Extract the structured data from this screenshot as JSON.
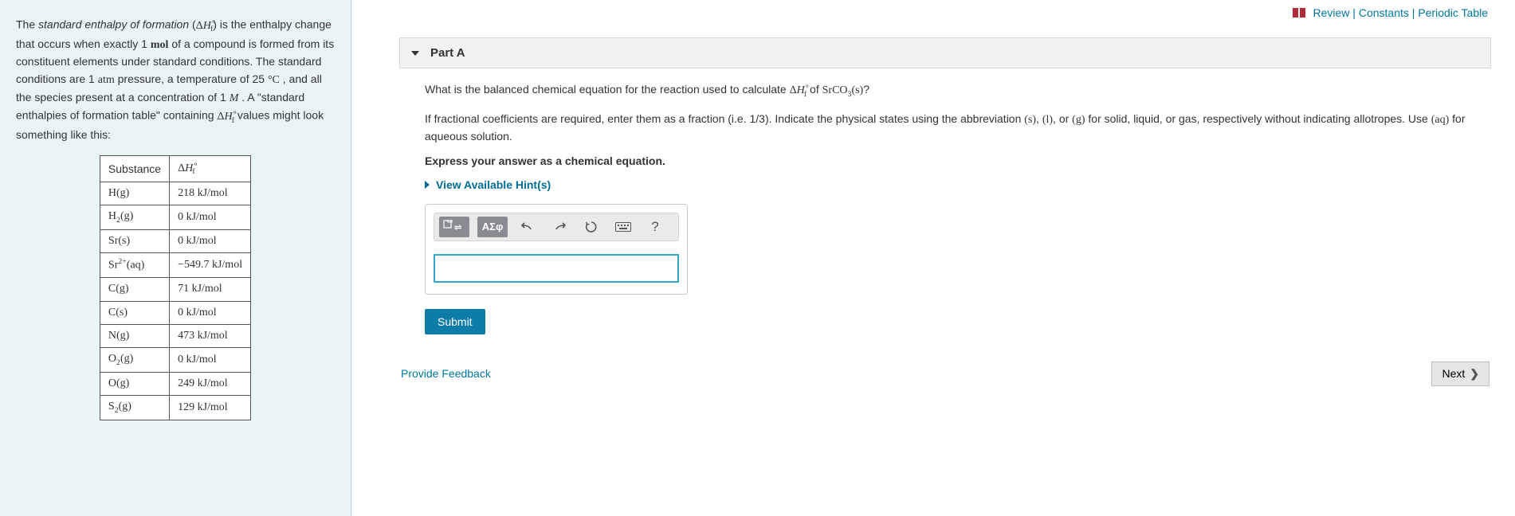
{
  "topLinks": {
    "review": "Review",
    "constants": "Constants",
    "periodic": "Periodic Table"
  },
  "intro": {
    "text1_a": "The ",
    "term": "standard enthalpy of formation",
    "text1_b": " (",
    "dHf_html": "ΔH∘f",
    "text1_c": ") is the enthalpy change that occurs when exactly 1 ",
    "mol": "mol",
    "text1_d": " of a compound is formed from its constituent elements under standard conditions. The standard conditions are 1 ",
    "atm": "atm",
    "text1_e": " pressure, a temperature of 25 ",
    "degC": "°C",
    "text1_f": " , and all the species present at a concentration of 1 ",
    "M": "M",
    "text1_g": " . A \"standard enthalpies of formation table\" containing ",
    "text1_h": " values might look something like this:"
  },
  "table": {
    "h1": "Substance",
    "h2_html": "ΔH∘f",
    "rows": [
      {
        "sub": "H(g)",
        "val": "218 kJ/mol"
      },
      {
        "sub": "H2(g)",
        "val": "0 kJ/mol"
      },
      {
        "sub": "Sr(s)",
        "val": "0 kJ/mol"
      },
      {
        "sub": "Sr2+(aq)",
        "val": "−549.7 kJ/mol"
      },
      {
        "sub": "C(g)",
        "val": "71 kJ/mol"
      },
      {
        "sub": "C(s)",
        "val": "0 kJ/mol"
      },
      {
        "sub": "N(g)",
        "val": "473 kJ/mol"
      },
      {
        "sub": "O2(g)",
        "val": "0 kJ/mol"
      },
      {
        "sub": "O(g)",
        "val": "249 kJ/mol"
      },
      {
        "sub": "S2(g)",
        "val": "129 kJ/mol"
      }
    ]
  },
  "partHeader": "Part A",
  "question": {
    "prompt_a": "What is the balanced chemical equation for the reaction used to calculate ",
    "prompt_b": " of ",
    "compound": "SrCO3(s)",
    "prompt_c": "?",
    "instructions": "If fractional coefficients are required, enter them as a fraction (i.e. 1/3). Indicate the physical states using the abbreviation (s), (l), or (g) for solid, liquid, or gas, respectively without indicating allotropes. Use (aq) for aqueous solution.",
    "express": "Express your answer as a chemical equation.",
    "viewHints": "View Available Hint(s)"
  },
  "toolbar": {
    "template": "□⇌",
    "greek": "ΑΣφ",
    "undo": "↶",
    "redo": "↷",
    "reset": "↻",
    "keyboard": "⌨",
    "help": "?"
  },
  "answerValue": "",
  "submit": "Submit",
  "feedback": "Provide Feedback",
  "next": "Next"
}
